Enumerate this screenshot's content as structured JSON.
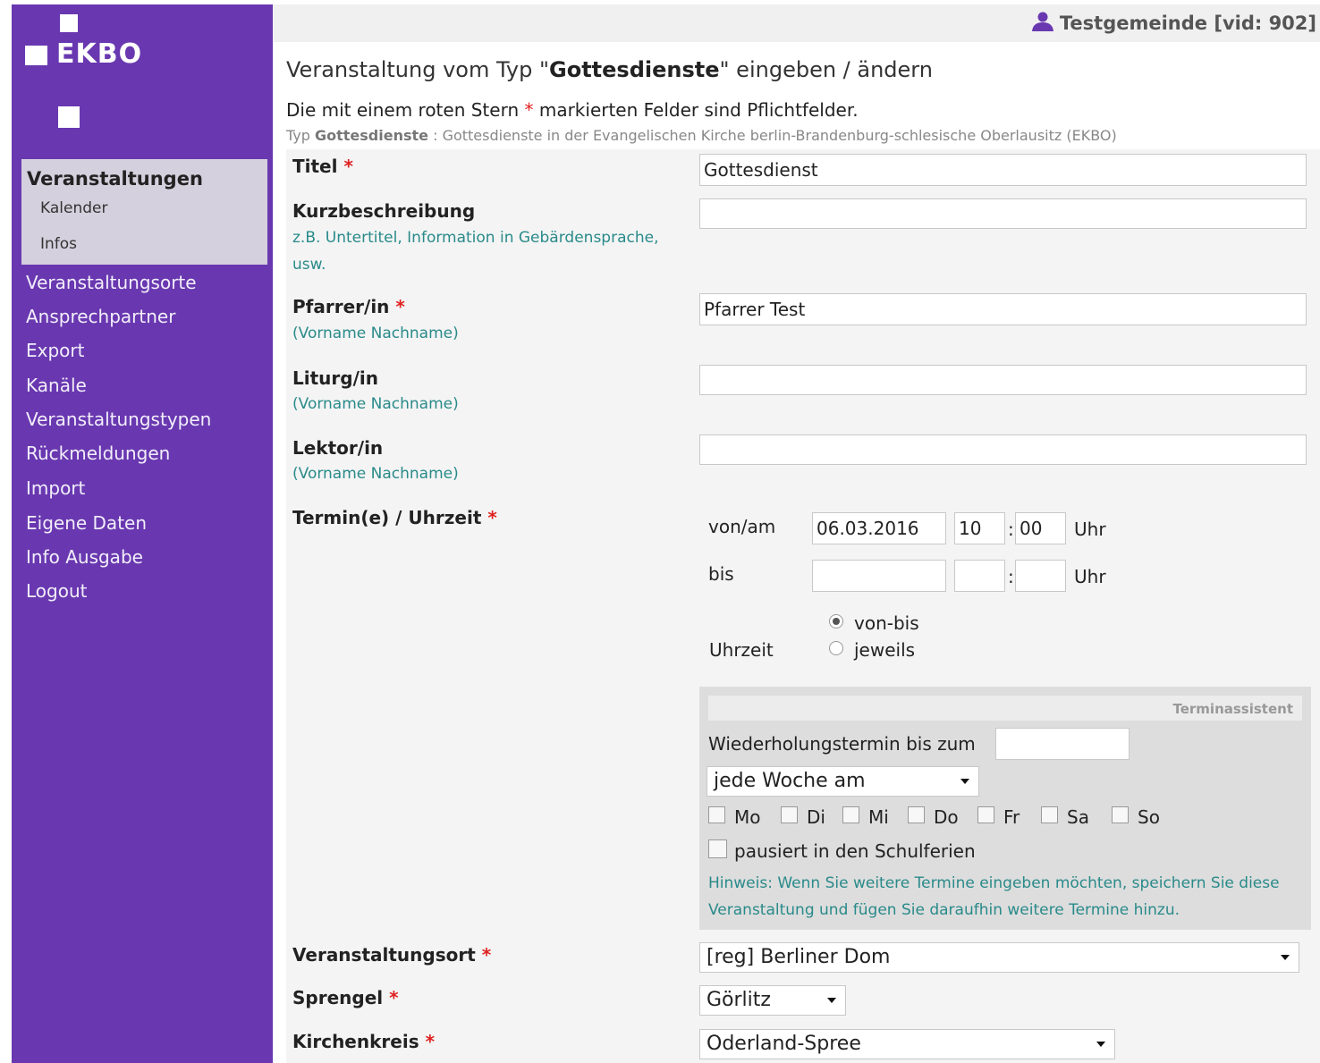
{
  "sidebar": {
    "logo_text": "EKBO",
    "group_title": "Veranstaltungen",
    "group_items": [
      "Kalender",
      "Infos"
    ],
    "links": [
      "Veranstaltungsorte",
      "Ansprechpartner",
      "Export",
      "Kanäle",
      "Veranstaltungstypen",
      "Rückmeldungen",
      "Import",
      "Eigene Daten",
      "Info Ausgabe",
      "Logout"
    ],
    "color": "#6938b0"
  },
  "header": {
    "user": "Testgemeinde [vid: 902]"
  },
  "page": {
    "title_pre": "Veranstaltung vom Typ \"",
    "title_type": "Gottesdienste",
    "title_post": "\" eingeben / ändern",
    "note_pre": "Die mit einem roten Stern ",
    "note_star": "*",
    "note_post": " markierten Felder sind Pflichtfelder.",
    "typ_pre": "Typ ",
    "typ_name": "Gottesdienste",
    "typ_post": " : Gottesdienste in der Evangelischen Kirche berlin-Brandenburg-schlesische Oberlausitz (EKBO)"
  },
  "form": {
    "star": "*",
    "titel": {
      "label": "Titel",
      "value": "Gottesdienst"
    },
    "kurz": {
      "label": "Kurzbeschreibung",
      "hint1": "z.B. Untertitel, Information in Gebärdensprache,",
      "hint2": "usw.",
      "value": ""
    },
    "pfarrer": {
      "label": "Pfarrer/in",
      "hint": "(Vorname Nachname)",
      "value": "Pfarrer Test"
    },
    "liturg": {
      "label": "Liturg/in",
      "hint": "(Vorname Nachname)",
      "value": ""
    },
    "lektor": {
      "label": "Lektor/in",
      "hint": "(Vorname Nachname)",
      "value": ""
    },
    "termin": {
      "label": "Termin(e) / Uhrzeit",
      "von_label": "von/am",
      "von_date": "06.03.2016",
      "von_hour": "10",
      "von_min": "00",
      "bis_label": "bis",
      "bis_date": "",
      "bis_hour": "",
      "bis_min": "",
      "colon": ":",
      "uhr": "Uhr",
      "uhrzeit_label": "Uhrzeit",
      "radio_von_bis": "von-bis",
      "radio_jeweils": "jeweils"
    },
    "assist": {
      "title": "Terminassistent",
      "wiederholung_label": "Wiederholungstermin bis zum",
      "wiederholung_value": "",
      "interval": "jede Woche am",
      "days": [
        "Mo",
        "Di",
        "Mi",
        "Do",
        "Fr",
        "Sa",
        "So"
      ],
      "schulferien": "pausiert in den Schulferien",
      "hinweis": "Hinweis: Wenn Sie weitere Termine eingeben möchten, speichern Sie diese Veranstaltung und fügen Sie daraufhin weitere Termine hinzu."
    },
    "ort": {
      "label": "Veranstaltungsort",
      "value": "[reg] Berliner Dom"
    },
    "sprengel": {
      "label": "Sprengel",
      "value": "Görlitz"
    },
    "kirchenkreis": {
      "label": "Kirchenkreis",
      "value": "Oderland-Spree"
    }
  }
}
